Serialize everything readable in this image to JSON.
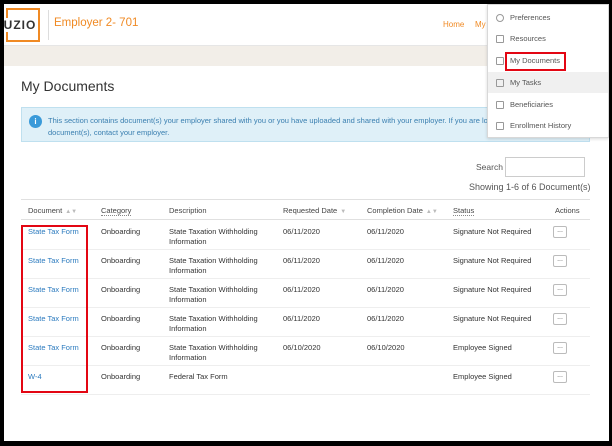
{
  "header": {
    "logo_text": "UZIO",
    "employer": "Employer 2- 701",
    "nav_home": "Home",
    "nav_my": "My"
  },
  "dropdown": {
    "items": [
      {
        "label": "Preferences",
        "icon": "gear-icon"
      },
      {
        "label": "Resources",
        "icon": "document-icon"
      },
      {
        "label": "My Documents",
        "icon": "document-search-icon"
      },
      {
        "label": "My Tasks",
        "icon": "checklist-icon"
      },
      {
        "label": "Beneficiaries",
        "icon": "document-icon"
      },
      {
        "label": "Enrollment History",
        "icon": "document-icon"
      }
    ]
  },
  "page": {
    "title": "My Documents",
    "info_line1": "This section contains document(s) your employer shared with you or you have uploaded and shared with your employer. If you are loo",
    "info_line2": "document(s), contact your employer."
  },
  "search": {
    "label": "Search",
    "value": ""
  },
  "showing": "Showing 1-6 of 6 Document(s)",
  "table": {
    "headers": {
      "document": "Document",
      "category": "Category",
      "description": "Description",
      "requested": "Requested Date",
      "completion": "Completion Date",
      "status": "Status",
      "actions": "Actions"
    },
    "action_label": "...",
    "rows": [
      {
        "document": "State Tax Form",
        "category": "Onboarding",
        "description": "State Taxation Withholding Information",
        "requested": "06/11/2020",
        "completion": "06/11/2020",
        "status": "Signature Not Required"
      },
      {
        "document": "State Tax Form",
        "category": "Onboarding",
        "description": "State Taxation Withholding Information",
        "requested": "06/11/2020",
        "completion": "06/11/2020",
        "status": "Signature Not Required"
      },
      {
        "document": "State Tax Form",
        "category": "Onboarding",
        "description": "State Taxation Withholding Information",
        "requested": "06/11/2020",
        "completion": "06/11/2020",
        "status": "Signature Not Required"
      },
      {
        "document": "State Tax Form",
        "category": "Onboarding",
        "description": "State Taxation Withholding Information",
        "requested": "06/11/2020",
        "completion": "06/11/2020",
        "status": "Signature Not Required"
      },
      {
        "document": "State Tax Form",
        "category": "Onboarding",
        "description": "State Taxation Withholding Information",
        "requested": "06/10/2020",
        "completion": "06/10/2020",
        "status": "Employee Signed"
      },
      {
        "document": "W-4",
        "category": "Onboarding",
        "description": "Federal Tax Form",
        "requested": "",
        "completion": "",
        "status": "Employee Signed"
      }
    ]
  },
  "colors": {
    "accent": "#f08a24",
    "link": "#2c7bbf",
    "highlight": "#e30613"
  }
}
